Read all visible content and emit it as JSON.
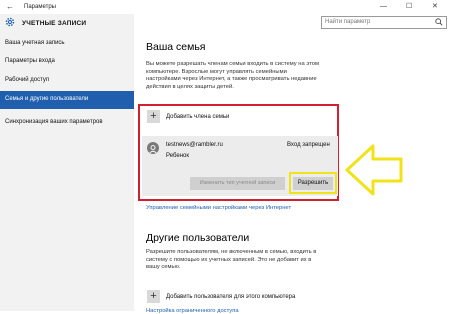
{
  "window": {
    "title": "Параметры",
    "back_icon": "back-arrow-icon",
    "controls": {
      "minimize": "—",
      "maximize": "☐",
      "close": "✕"
    }
  },
  "sidebar": {
    "header": "УЧЕТНЫЕ ЗАПИСИ",
    "header_icon": "gear-icon",
    "items": [
      {
        "label": "Ваша учетная запись",
        "active": false
      },
      {
        "label": "Параметры входа",
        "active": false
      },
      {
        "label": "Рабочий доступ",
        "active": false
      },
      {
        "label": "Семья и другие пользователи",
        "active": true
      },
      {
        "label": "Синхронизация ваших параметров",
        "active": false
      }
    ]
  },
  "search": {
    "placeholder": "Найти параметр"
  },
  "family": {
    "title": "Ваша семья",
    "description": [
      "Вы можете разрешать членам семьи входить в систему на этом",
      "компьютере. Взрослые могут управлять семейными",
      "настройками через Интернет, а также просматривать недавние",
      "действия в целях защиты детей."
    ],
    "add_label": "Добавить члена семьи",
    "member": {
      "email": "testnews@rambler.ru",
      "role": "Ребенок",
      "status": "Вход запрещен",
      "change_button": "Изменить тип учетной записи",
      "allow_button": "Разрешить"
    },
    "manage_link": "Управление семейными настройками через Интернет"
  },
  "others": {
    "title": "Другие пользователи",
    "description": [
      "Разрешите пользователям, не включенным в семью, входить в",
      "систему с помощью их учетных записей. Это не добавит их в",
      "вашу семью."
    ],
    "add_label": "Добавить пользователя для этого компьютера",
    "restricted_link": "Настройка ограниченного доступа"
  },
  "colors": {
    "accent": "#1f5fae",
    "highlight_box": "#d32030",
    "annotation": "#f0e31a"
  }
}
